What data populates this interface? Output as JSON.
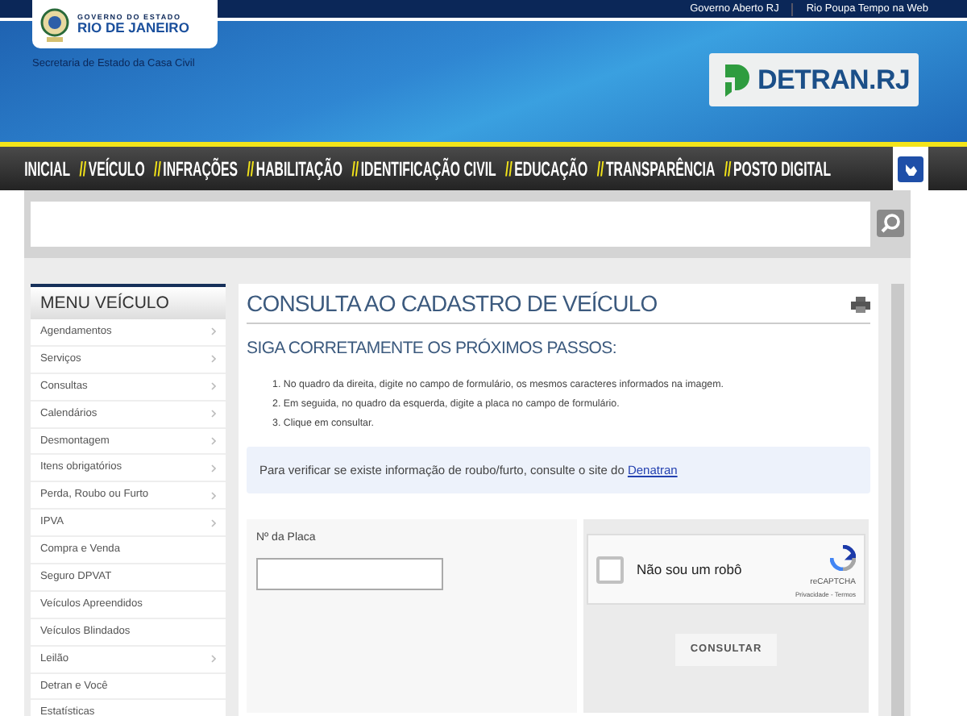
{
  "top_links": [
    "Governo Aberto RJ",
    "Rio Poupa Tempo na Web"
  ],
  "gov_logo": {
    "line_1": "GOVERNO DO ESTADO",
    "line_2": "RIO DE JANEIRO"
  },
  "secretaria": "Secretaria de Estado da Casa Civil",
  "detran_logo": "DETRAN.RJ",
  "nav": [
    {
      "label": "INICIAL"
    },
    {
      "prefix": "//",
      "label": "VEÍCULO"
    },
    {
      "prefix": "//",
      "label": "INFRAÇÕES"
    },
    {
      "prefix": "//",
      "label": "HABILITAÇÃO"
    },
    {
      "prefix": "//",
      "label": "IDENTIFICAÇÃO CIVIL"
    },
    {
      "prefix": "//",
      "label": "EDUCAÇÃO"
    },
    {
      "prefix": "//",
      "label": "TRANSPARÊNCIA"
    },
    {
      "prefix": "//",
      "label": "POSTO DIGITAL"
    }
  ],
  "sidebar": {
    "title": "MENU VEÍCULO",
    "items": [
      {
        "label": "Agendamentos",
        "submenu": true
      },
      {
        "label": "Serviços",
        "submenu": true
      },
      {
        "label": "Consultas",
        "submenu": true
      },
      {
        "label": "Calendários",
        "submenu": true
      },
      {
        "label": "Desmontagem",
        "submenu": true
      },
      {
        "label": "Itens obrigatórios",
        "submenu": true
      },
      {
        "label": "Perda, Roubo ou Furto",
        "submenu": true
      },
      {
        "label": "IPVA",
        "submenu": true
      },
      {
        "label": "Compra e Venda",
        "submenu": false
      },
      {
        "label": "Seguro DPVAT",
        "submenu": false
      },
      {
        "label": "Veículos Apreendidos",
        "submenu": false
      },
      {
        "label": "Veículos Blindados",
        "submenu": false
      },
      {
        "label": "Leilão",
        "submenu": true
      },
      {
        "label": "Detran e Você",
        "submenu": false
      },
      {
        "label": "Estatísticas",
        "submenu": false
      }
    ]
  },
  "main": {
    "title": "CONSULTA AO CADASTRO DE VEÍCULO",
    "subtitle": "SIGA CORRETAMENTE OS PRÓXIMOS PASSOS:",
    "steps": [
      "1. No quadro da direita, digite no campo de formulário, os mesmos caracteres informados na imagem.",
      "2. Em seguida, no quadro da esquerda, digite a placa no campo de formulário.",
      "3. Clique em consultar."
    ],
    "notice": {
      "text": "Para verificar se existe informação de roubo/furto, consulte o site do",
      "link": "Denatran"
    },
    "plate_label": "Nº da Placa",
    "captcha": {
      "label": "Não sou um robô",
      "checked": false,
      "brand": "reCAPTCHA",
      "links": "Privacidade - Termos"
    },
    "submit": "CONSULTAR"
  }
}
